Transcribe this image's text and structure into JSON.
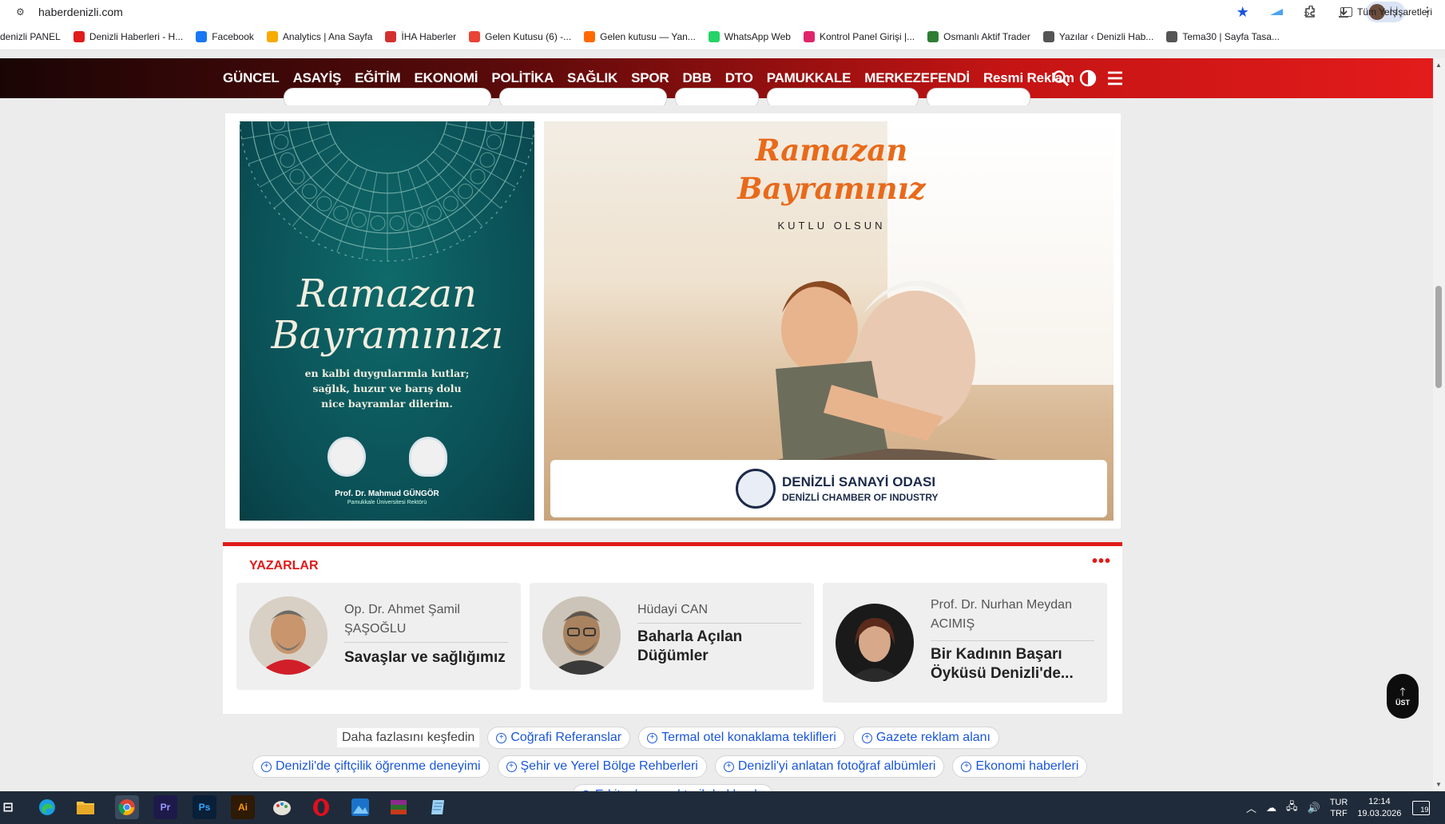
{
  "browser": {
    "url": "haberdenizli.com",
    "profile_label": "İş",
    "bookmarks": [
      {
        "label": "denizli PANEL",
        "color": ""
      },
      {
        "label": "Denizli Haberleri - H...",
        "color": "#e01b1b"
      },
      {
        "label": "Facebook",
        "color": "#1877f2"
      },
      {
        "label": "Analytics | Ana Sayfa",
        "color": "#f9ab00"
      },
      {
        "label": "İHA Haberler",
        "color": "#d32f2f"
      },
      {
        "label": "Gelen Kutusu (6) -...",
        "color": "#ea4335"
      },
      {
        "label": "Gelen kutusu — Yan...",
        "color": "#ff6a00"
      },
      {
        "label": "WhatsApp Web",
        "color": "#25d366"
      },
      {
        "label": "Kontrol Panel Girişi |...",
        "color": "#e0246b"
      },
      {
        "label": "Osmanlı Aktif Trader",
        "color": "#2e7d32"
      },
      {
        "label": "Yazılar ‹ Denizli Hab...",
        "color": "#555555"
      },
      {
        "label": "Tema30 | Sayfa Tasa...",
        "color": "#555555"
      }
    ],
    "bookmarks_more": "»",
    "all_bookmarks": "Tüm Yer İşaretleri"
  },
  "nav": {
    "links": [
      "GÜNCEL",
      "ASAYİŞ",
      "EĞİTİM",
      "EKONOMİ",
      "POLİTİKA",
      "SAĞLIK",
      "SPOR",
      "DBB",
      "DTO",
      "PAMUKKALE",
      "MERKEZEFENDİ",
      "Resmi Reklam"
    ]
  },
  "ads": {
    "left": {
      "title_line1": "Ramazan",
      "title_line2": "Bayramınızı",
      "message_line1": "en kalbi duygularımla kutlar;",
      "message_line2": "sağlık, huzur ve barış dolu",
      "message_line3": "nice bayramlar dilerim.",
      "name": "Prof. Dr. Mahmud GÜNGÖR",
      "role": "Pamukkale Üniversitesi Rektörü"
    },
    "right": {
      "title_line1": "Ramazan",
      "title_line2": "Bayramınız",
      "subtitle": "KUTLU OLSUN",
      "org_tr": "DENİZLİ SANAYİ ODASI",
      "org_en": "DENİZLİ CHAMBER OF INDUSTRY"
    }
  },
  "writers": {
    "heading": "YAZARLAR",
    "more": "•••",
    "items": [
      {
        "name": "Op. Dr. Ahmet Şamil ŞAŞOĞLU",
        "title": "Savaşlar ve sağlığımız"
      },
      {
        "name": "Hüdayi CAN",
        "title": "Baharla Açılan Düğümler"
      },
      {
        "name": "Prof. Dr. Nurhan Meydan ACIMIŞ",
        "title": "Bir Kadının Başarı Öyküsü Denizli'de..."
      }
    ]
  },
  "discover": {
    "label": "Daha fazlasını keşfedin",
    "row1": [
      "Coğrafi Referanslar",
      "Termal otel konaklama teklifleri",
      "Gazete reklam alanı"
    ],
    "row2": [
      "Denizli'de çiftçilik öğrenme deneyimi",
      "Şehir ve Yerel Bölge Rehberleri",
      "Denizli'yi anlatan fotoğraf albümleri",
      "Ekonomi haberleri"
    ],
    "row3": [
      "E-kitaplar yerel tarih hakkında"
    ]
  },
  "top_button": {
    "arrow": "🡑",
    "label": "ÜST"
  },
  "taskbar": {
    "lang_line1": "TUR",
    "lang_line2": "TRF",
    "time": "12:14",
    "date": "19.03.2026",
    "notifications": "19"
  }
}
